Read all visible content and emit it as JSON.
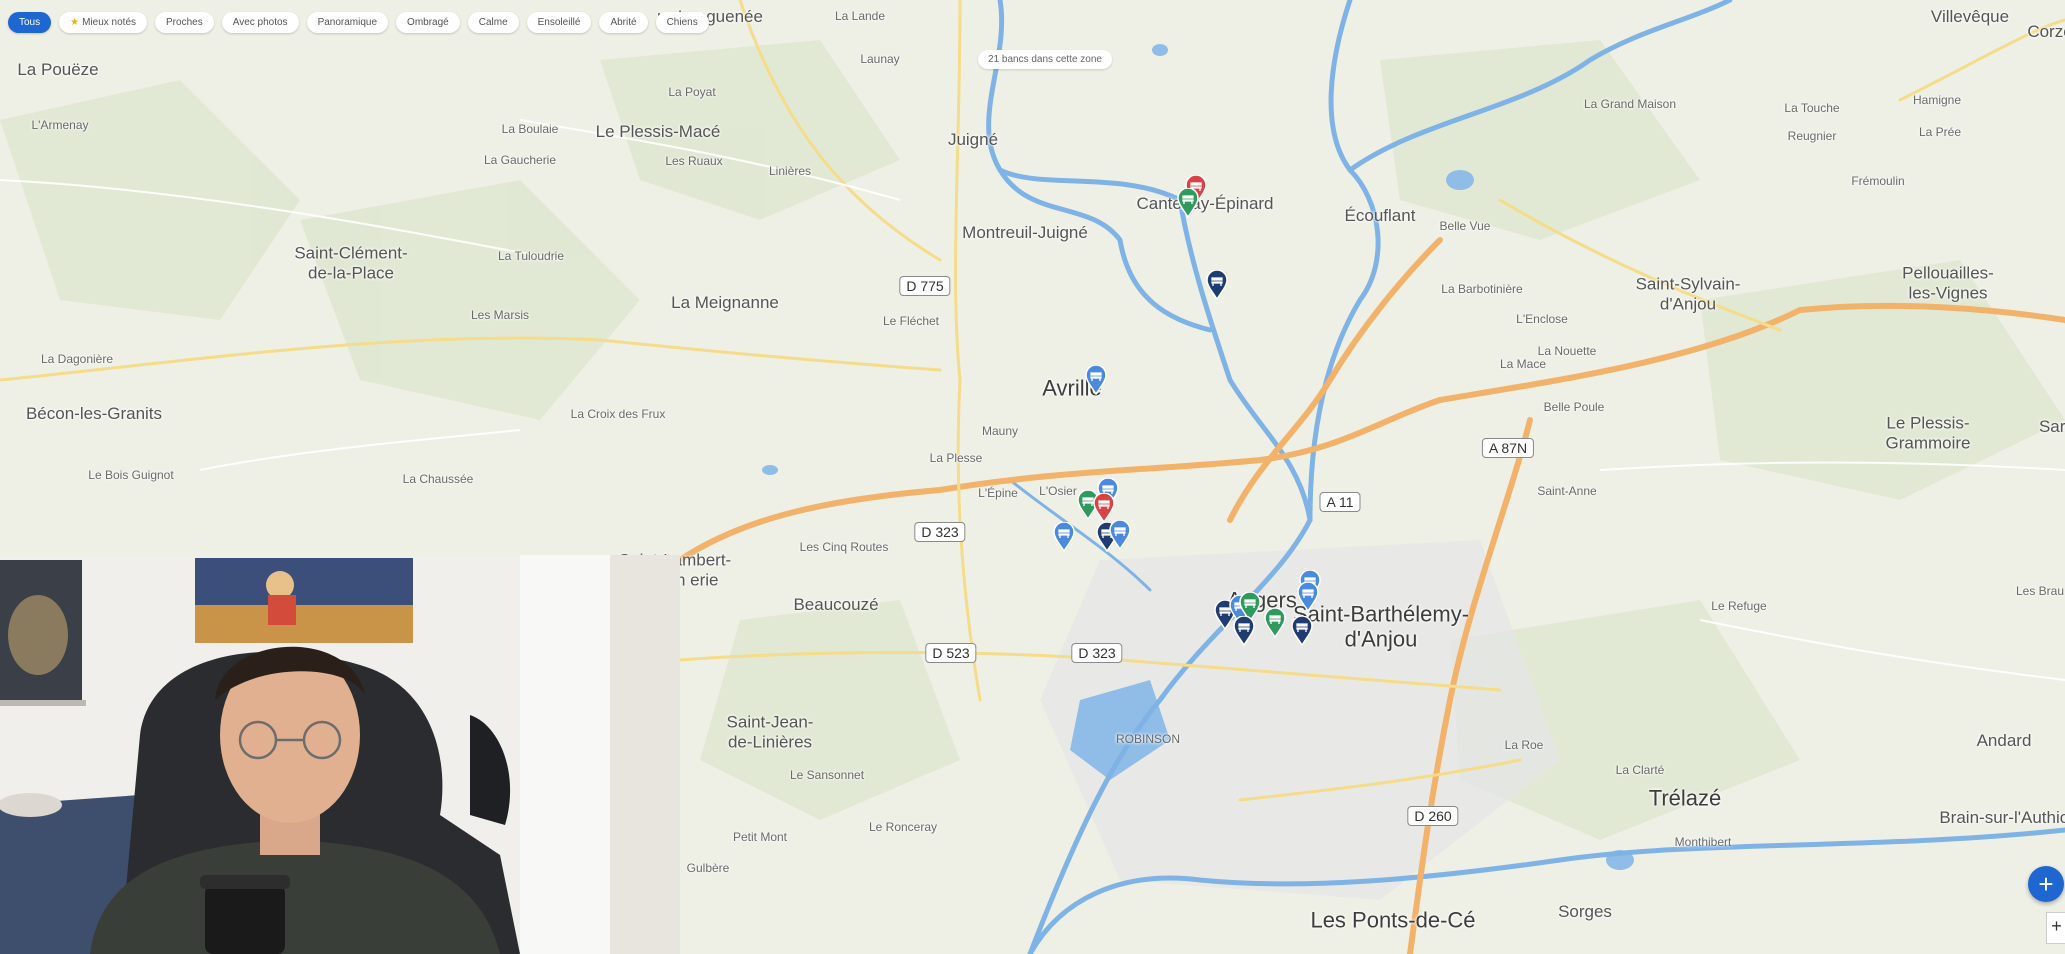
{
  "filters": {
    "chips": [
      {
        "label": "Tous",
        "active": true
      },
      {
        "label": "Mieux notés",
        "star": true
      },
      {
        "label": "Proches"
      },
      {
        "label": "Avec photos"
      },
      {
        "label": "Panoramique"
      },
      {
        "label": "Ombragé"
      },
      {
        "label": "Calme"
      },
      {
        "label": "Ensoleillé"
      },
      {
        "label": "Abrité"
      },
      {
        "label": "Chiens"
      }
    ]
  },
  "count_badge": "21 bancs dans cette zone",
  "places": [
    {
      "name": "ur-Longuenée",
      "size": "md"
    },
    {
      "name": "La Lande",
      "size": "sm"
    },
    {
      "name": "Launay",
      "size": "sm"
    },
    {
      "name": "Villevêque",
      "size": "md"
    },
    {
      "name": "Corzé",
      "size": "md"
    },
    {
      "name": "La Pouëze",
      "size": "md"
    },
    {
      "name": "L'Armenay",
      "size": "sm"
    },
    {
      "name": "La Poyat",
      "size": "sm"
    },
    {
      "name": "La Boulaie",
      "size": "sm"
    },
    {
      "name": "Le Plessis-Macé",
      "size": "md"
    },
    {
      "name": "Juigné",
      "size": "md"
    },
    {
      "name": "La Grand Maison",
      "size": "sm"
    },
    {
      "name": "La Touche",
      "size": "sm"
    },
    {
      "name": "Hamigne",
      "size": "sm"
    },
    {
      "name": "Reugnier",
      "size": "sm"
    },
    {
      "name": "La Prée",
      "size": "sm"
    },
    {
      "name": "La Gaucherie",
      "size": "sm"
    },
    {
      "name": "Les Ruaux",
      "size": "sm"
    },
    {
      "name": "Linières",
      "size": "sm"
    },
    {
      "name": "Frémoulin",
      "size": "sm"
    },
    {
      "name": "Cantenay-Épinard",
      "size": "md"
    },
    {
      "name": "Écouflant",
      "size": "md"
    },
    {
      "name": "Belle Vue",
      "size": "sm"
    },
    {
      "name": "Montreuil-Juigné",
      "size": "md"
    },
    {
      "name": "Saint-Clément-\nde-la-Place",
      "size": "md"
    },
    {
      "name": "La Tuloudrie",
      "size": "sm"
    },
    {
      "name": "Saint-Sylvain-\nd'Anjou",
      "size": "md"
    },
    {
      "name": "Pellouailles-\nles-Vignes",
      "size": "md"
    },
    {
      "name": "La Barbotinière",
      "size": "sm"
    },
    {
      "name": "La Meignanne",
      "size": "md"
    },
    {
      "name": "Les Marsis",
      "size": "sm"
    },
    {
      "name": "Le Fléchet",
      "size": "sm"
    },
    {
      "name": "L'Enclose",
      "size": "sm"
    },
    {
      "name": "La Dagonière",
      "size": "sm"
    },
    {
      "name": "La Nouette",
      "size": "sm"
    },
    {
      "name": "La Mace",
      "size": "sm"
    },
    {
      "name": "Avrillé",
      "size": "lg"
    },
    {
      "name": "Bécon-les-Granits",
      "size": "md"
    },
    {
      "name": "La Croix des Frux",
      "size": "sm"
    },
    {
      "name": "Belle Poule",
      "size": "sm"
    },
    {
      "name": "Le Plessis-\nGrammoire",
      "size": "md"
    },
    {
      "name": "Sarr",
      "size": "md"
    },
    {
      "name": "Mauny",
      "size": "sm"
    },
    {
      "name": "La Plesse",
      "size": "sm"
    },
    {
      "name": "Le Bois Guignot",
      "size": "sm"
    },
    {
      "name": "La Chaussée",
      "size": "sm"
    },
    {
      "name": "L'Épine",
      "size": "sm"
    },
    {
      "name": "L'Osier",
      "size": "sm"
    },
    {
      "name": "Saint-Anne",
      "size": "sm"
    },
    {
      "name": "Les Cinq Routes",
      "size": "sm"
    },
    {
      "name": "Saint-Lambert-\nla-Poth erie",
      "size": "md"
    },
    {
      "name": "Les Brau",
      "size": "sm"
    },
    {
      "name": "Beaucouzé",
      "size": "md"
    },
    {
      "name": "Angers",
      "size": "lg"
    },
    {
      "name": "Le Refuge",
      "size": "sm"
    },
    {
      "name": "Saint-Barthélemy-\nd'Anjou",
      "size": "lg"
    },
    {
      "name": "Saint-Jean-\nde-Linières",
      "size": "md"
    },
    {
      "name": "ROBINSON",
      "size": "sm"
    },
    {
      "name": "Andard",
      "size": "md"
    },
    {
      "name": "La Roe",
      "size": "sm"
    },
    {
      "name": "La Clarté",
      "size": "sm"
    },
    {
      "name": "Le Sansonnet",
      "size": "sm"
    },
    {
      "name": "Trélazé",
      "size": "lg"
    },
    {
      "name": "Brain-sur-l'Authion",
      "size": "md"
    },
    {
      "name": "Petit Mont",
      "size": "sm"
    },
    {
      "name": "Le Ronceray",
      "size": "sm"
    },
    {
      "name": "Monthibert",
      "size": "sm"
    },
    {
      "name": "Gulbère",
      "size": "sm"
    },
    {
      "name": "Les Ponts-de-Cé",
      "size": "lg"
    },
    {
      "name": "Sorges",
      "size": "md"
    }
  ],
  "roads": [
    "D 775",
    "A 87N",
    "D 323",
    "A 11",
    "D 323",
    "D 523",
    "D 260"
  ],
  "markers": [
    {
      "color": "#d84343",
      "icon": "bench"
    },
    {
      "color": "#2f9a5c",
      "icon": "bench"
    },
    {
      "color": "#1f3d73",
      "icon": "bench"
    },
    {
      "color": "#4a8be0",
      "icon": "bench"
    },
    {
      "color": "#4a8be0",
      "icon": "bench"
    },
    {
      "color": "#2f9a5c",
      "icon": "bench"
    },
    {
      "color": "#d84343",
      "icon": "bench"
    },
    {
      "color": "#4a8be0",
      "icon": "bench"
    },
    {
      "color": "#1f3d73",
      "icon": "bench"
    },
    {
      "color": "#4a8be0",
      "icon": "bench"
    },
    {
      "color": "#1f3d73",
      "icon": "bench"
    },
    {
      "color": "#4a8be0",
      "icon": "bench"
    },
    {
      "color": "#2f9a5c",
      "icon": "bench"
    },
    {
      "color": "#1f3d73",
      "icon": "bench"
    },
    {
      "color": "#2f9a5c",
      "icon": "bench"
    },
    {
      "color": "#4a8be0",
      "icon": "bench"
    },
    {
      "color": "#4a8be0",
      "icon": "bench"
    },
    {
      "color": "#1f3d73",
      "icon": "bench"
    }
  ],
  "add_button": "+",
  "zoom_in": "+",
  "colors": {
    "accent": "#1e66d0",
    "water": "#7fb3e6",
    "road_major": "#f2b26a",
    "road_minor": "#f5dc8a"
  }
}
